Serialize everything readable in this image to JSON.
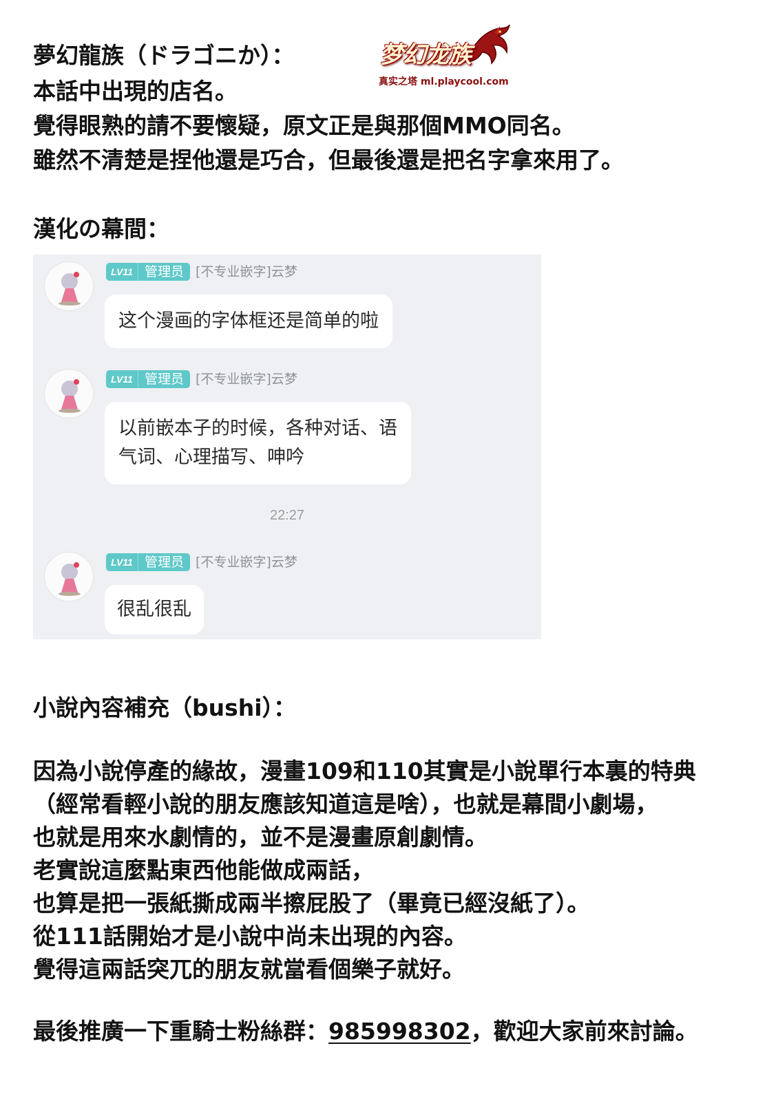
{
  "header": {
    "line1": "夢幻龍族（ドラゴニか）：",
    "line2": "本話中出現的店名。",
    "line3": "覺得眼熟的請不要懷疑，原文正是與那個MMO同名。",
    "line4": "雖然不清楚是捏他還是巧合，但最後還是把名字拿來用了。"
  },
  "logo": {
    "title": "梦幻龙族",
    "subtitle": "真实之塔 ml.playcool.com"
  },
  "section_title": "漢化の幕間：",
  "chat": {
    "timestamp": "22:27",
    "messages": [
      {
        "level": "LV11",
        "role": "管理员",
        "sender": "[不专业嵌字]云梦",
        "text_lines": [
          "这个漫画的字体框还是简单的啦"
        ]
      },
      {
        "level": "LV11",
        "role": "管理员",
        "sender": "[不专业嵌字]云梦",
        "text_lines": [
          "以前嵌本子的时候，各种对话、语",
          "气词、心理描写、呻吟"
        ]
      },
      {
        "level": "LV11",
        "role": "管理员",
        "sender": "[不专业嵌字]云梦",
        "text_lines": [
          "很乱很乱"
        ]
      }
    ]
  },
  "novel": {
    "title": "小說內容補充（bushi）：",
    "lines": [
      "因為小說停產的緣故，漫畫109和110其實是小說單行本裏的特典",
      "（經常看輕小說的朋友應該知道這是啥），也就是幕間小劇場，",
      "也就是用來水劇情的，並不是漫畫原創劇情。",
      "老實說這麼點東西他能做成兩話，",
      "也算是把一張紙撕成兩半擦屁股了（畢竟已經沒紙了）。",
      "從111話開始才是小說中尚未出現的內容。",
      "覺得這兩話突兀的朋友就當看個樂子就好。"
    ]
  },
  "footer": {
    "prefix": "最後推廣一下重騎士粉絲群：",
    "group_number": "985998302",
    "suffix": "，歡迎大家前來討論。"
  },
  "colors": {
    "badge": "#5fc8c9",
    "chat_background": "#eef0f3",
    "bubble": "#ffffff",
    "logo_red": "#a00000"
  }
}
